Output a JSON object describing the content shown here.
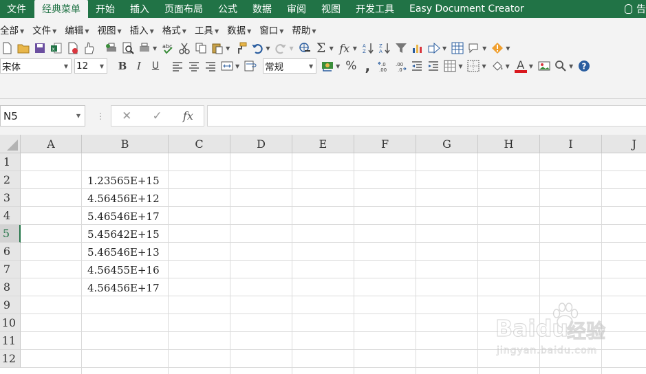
{
  "ribbon": {
    "tabs": [
      "文件",
      "经典菜单",
      "开始",
      "插入",
      "页面布局",
      "公式",
      "数据",
      "审阅",
      "视图",
      "开发工具",
      "Easy Document Creator"
    ],
    "active_tab": "经典菜单",
    "tell_me": "告"
  },
  "classic_menu": [
    "全部",
    "文件",
    "编辑",
    "视图",
    "插入",
    "格式",
    "工具",
    "数据",
    "窗口",
    "帮助"
  ],
  "format_bar": {
    "font_name": "宋体",
    "font_size": "12",
    "bold": "B",
    "italic": "I",
    "underline": "U",
    "number_format": "常规",
    "percent": "%",
    "font_color_letter": "A"
  },
  "formula_bar": {
    "name_box": "N5",
    "cancel": "✕",
    "enter": "✓",
    "fx": "fx",
    "formula": ""
  },
  "sheet": {
    "columns": [
      "A",
      "B",
      "C",
      "D",
      "E",
      "F",
      "G",
      "H",
      "I",
      "J"
    ],
    "rows": [
      "1",
      "2",
      "3",
      "4",
      "5",
      "6",
      "7",
      "8",
      "9",
      "10",
      "11",
      "12"
    ],
    "selected_row": "5",
    "cells_B": [
      "",
      "1.23565E+15",
      "4.56456E+12",
      "5.46546E+17",
      "5.45642E+15",
      "5.46546E+13",
      "4.56455E+16",
      "4.56456E+17",
      "",
      "",
      "",
      ""
    ]
  },
  "watermark": {
    "logo": "Baidu",
    "cn": "经验",
    "url": "jingyan.baidu.com"
  },
  "colors": {
    "excel_green": "#217346",
    "ribbon_bg": "#f3f3f3",
    "header_bg": "#e6e6e6"
  }
}
